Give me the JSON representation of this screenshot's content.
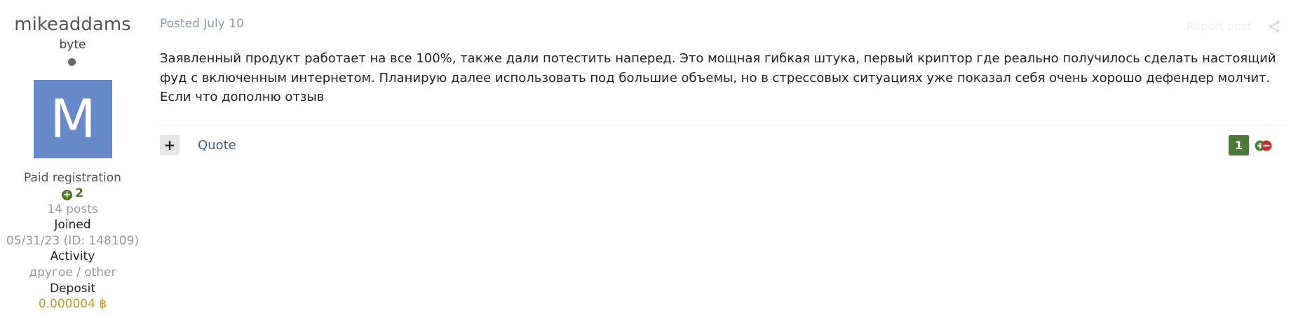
{
  "author": {
    "name": "mikeaddams",
    "title": "byte",
    "avatar_letter": "M",
    "group": "Paid registration",
    "reputation": "2",
    "posts": "14 posts",
    "joined_label": "Joined",
    "joined_value": "05/31/23 (ID: 148109)",
    "activity_label": "Activity",
    "activity_value": "другое / other",
    "deposit_label": "Deposit",
    "deposit_value": "0.000004 ฿"
  },
  "post": {
    "date": "Posted July 10",
    "report_label": "Report post",
    "body": "Заявленный продукт работает на все 100%, также дали потестить наперед. Это мощная гибкая штука, первый криптор где реально получилось сделать настоящий фуд с включенным интернетом. Планирую далее использовать под большие объемы, но в стрессовых ситуациях уже показал себя очень хорошо дефендер молчит. Если что дополню отзыв",
    "multiquote_label": "+",
    "quote_label": "Quote",
    "reputation_count": "1"
  },
  "colors": {
    "avatar_bg": "#6689c9",
    "reputation_green": "#4a7a1f",
    "deposit_gold": "#c89a1a",
    "link_blue": "#3d6594"
  }
}
